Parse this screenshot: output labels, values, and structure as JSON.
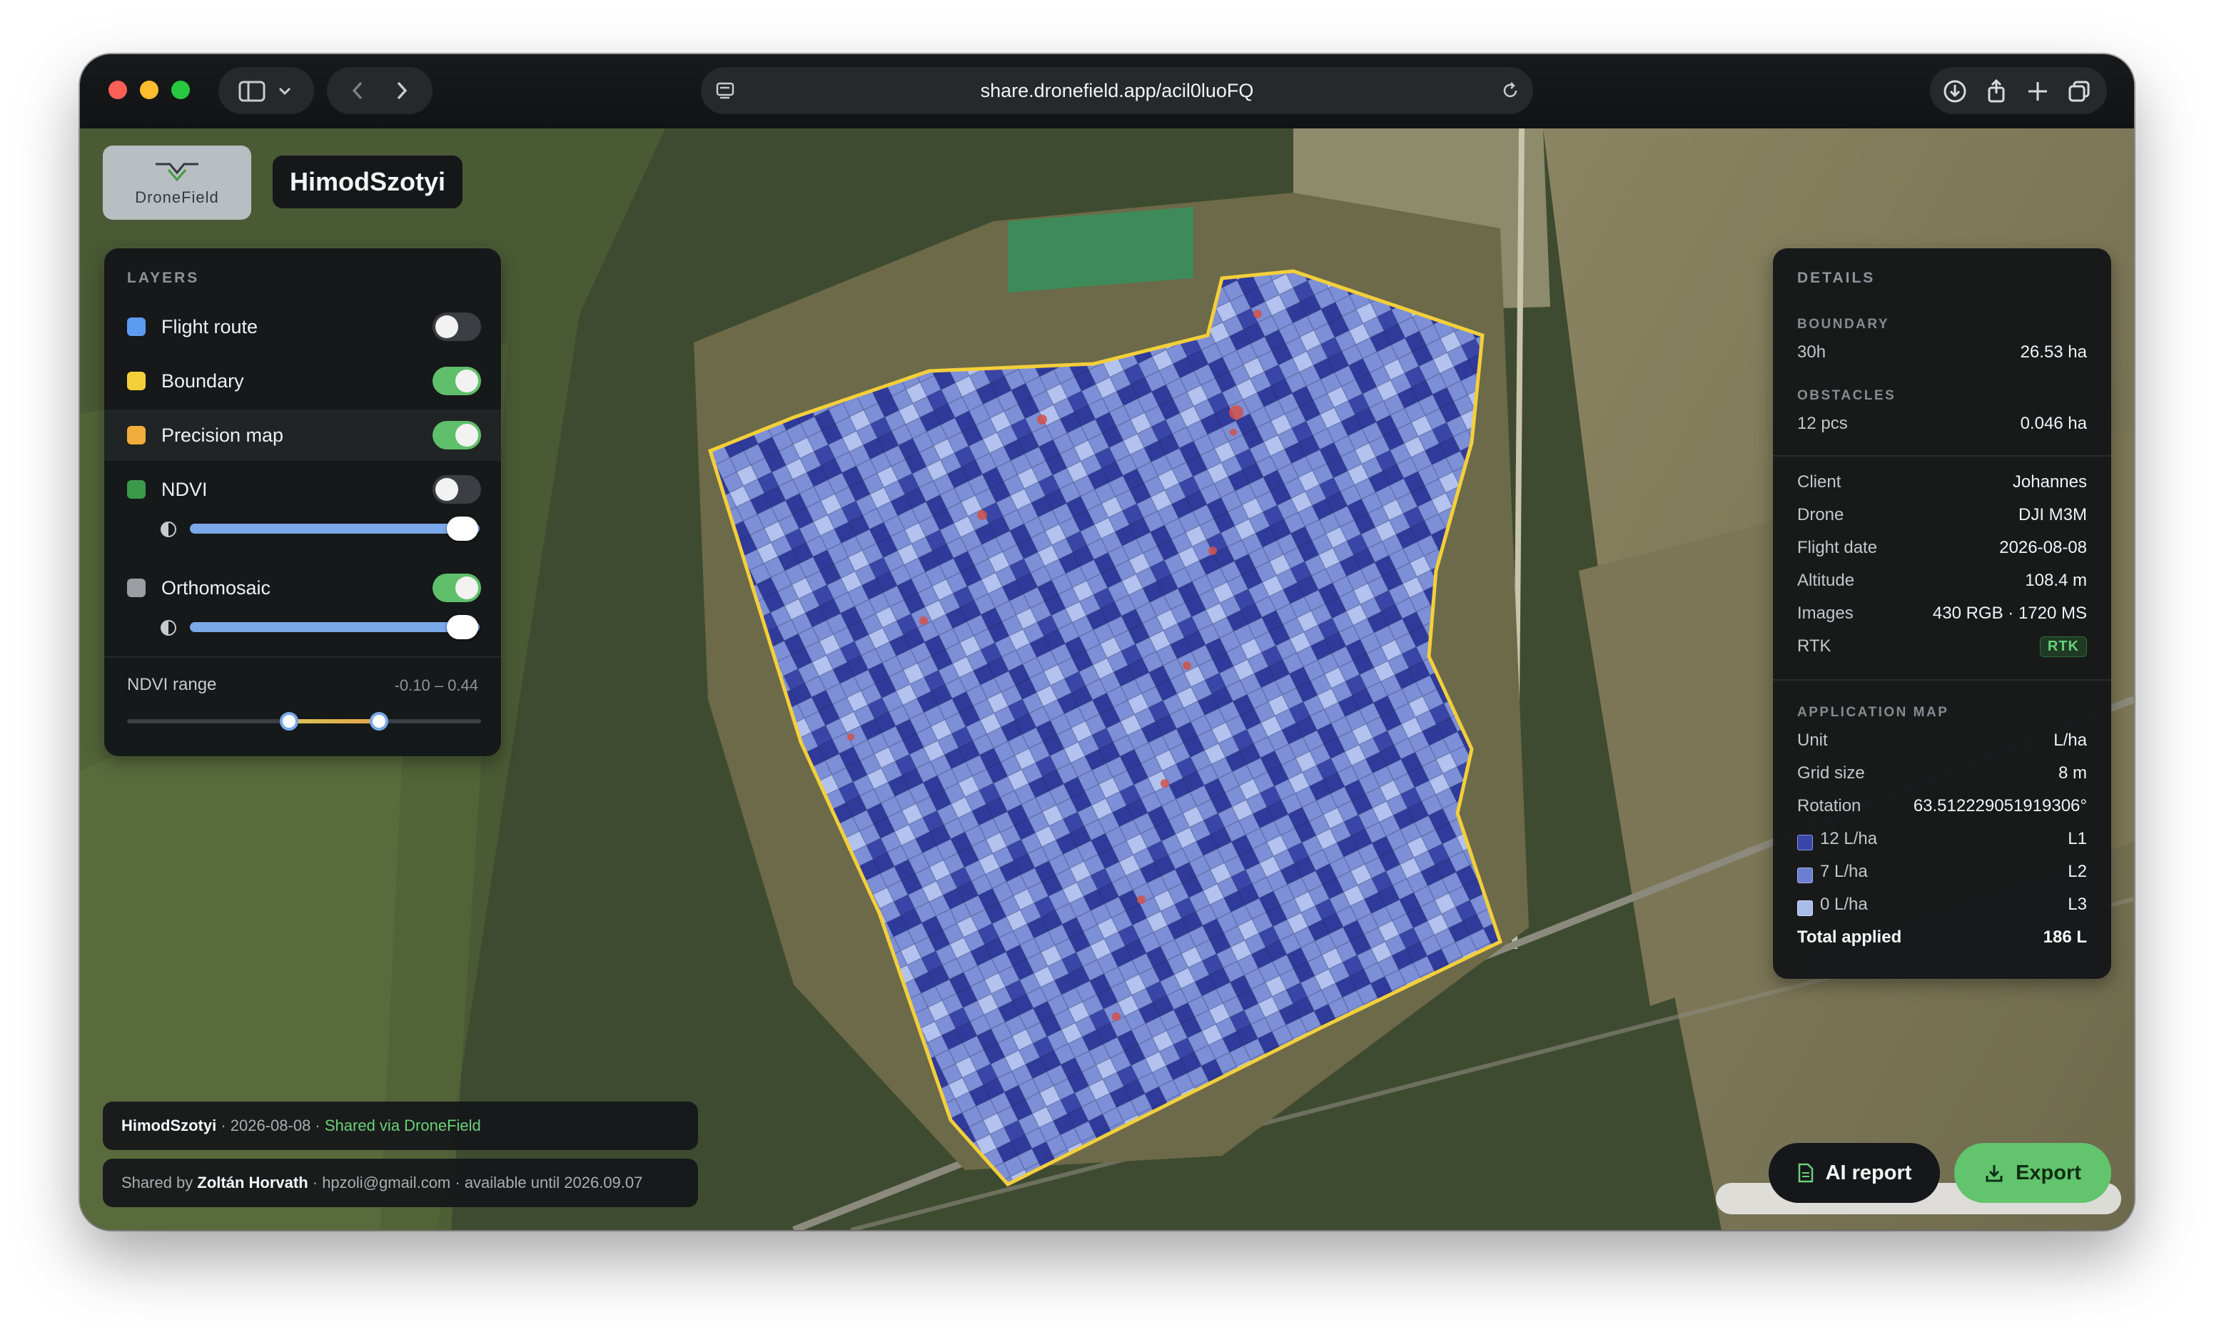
{
  "browser": {
    "url": "share.dronefield.app/acil0luoFQ"
  },
  "header": {
    "logo_text": "DroneField",
    "field_name": "HimodSzotyi"
  },
  "layers": {
    "title": "LAYERS",
    "items": [
      {
        "label": "Flight route",
        "color": "#5b9cf0",
        "enabled": false
      },
      {
        "label": "Boundary",
        "color": "#f3cf3a",
        "enabled": true
      },
      {
        "label": "Precision map",
        "color": "#f0ad3c",
        "enabled": true
      },
      {
        "label": "NDVI",
        "color": "#3a9a4a",
        "enabled": false,
        "opacity": 1.0
      },
      {
        "label": "Orthomosaic",
        "color": "#9a9ea3",
        "enabled": true,
        "opacity": 1.0
      }
    ],
    "ndvi_range_label": "NDVI range",
    "ndvi_range_value": "-0.10 – 0.44",
    "ndvi_range": [
      -0.1,
      0.44
    ]
  },
  "details": {
    "title": "DETAILS",
    "boundary": {
      "label": "BOUNDARY",
      "name": "30h",
      "area": "26.53 ha"
    },
    "obstacles": {
      "label": "OBSTACLES",
      "count": "12 pcs",
      "area": "0.046 ha"
    },
    "rows": [
      {
        "k": "Client",
        "v": "Johannes"
      },
      {
        "k": "Drone",
        "v": "DJI M3M"
      },
      {
        "k": "Flight date",
        "v": "2026-08-08"
      },
      {
        "k": "Altitude",
        "v": "108.4 m"
      },
      {
        "k": "Images",
        "v": "430 RGB · 1720 MS"
      },
      {
        "k": "RTK",
        "v": "RTK"
      }
    ],
    "application_map": {
      "label": "APPLICATION MAP",
      "unit_k": "Unit",
      "unit_v": "L/ha",
      "grid_k": "Grid size",
      "grid_v": "8 m",
      "rotation_k": "Rotation",
      "rotation_v": "63.512229051919306°",
      "levels": [
        {
          "k": "12 L/ha",
          "v": "L1",
          "color": "#3a45a8"
        },
        {
          "k": "7 L/ha",
          "v": "L2",
          "color": "#6b7fd0"
        },
        {
          "k": "0 L/ha",
          "v": "L3",
          "color": "#a9bbe8"
        }
      ],
      "total_k": "Total applied",
      "total_v": "186 L"
    }
  },
  "footer": {
    "field": "HimodSzotyi",
    "date": " · 2026-08-08 · ",
    "shared_via": "Shared via DroneField",
    "shared_by_prefix": "Shared by ",
    "shared_by_name": "Zoltán Horvath",
    "email": " · hpzoli@gmail.com · ",
    "availability": "available until 2026.09.07"
  },
  "actions": {
    "ai_report": "AI report",
    "export": "Export"
  },
  "colors": {
    "accent_green": "#62c46d",
    "boundary_yellow": "#f3cf3a",
    "grid_blue": "#6b7fd0"
  }
}
